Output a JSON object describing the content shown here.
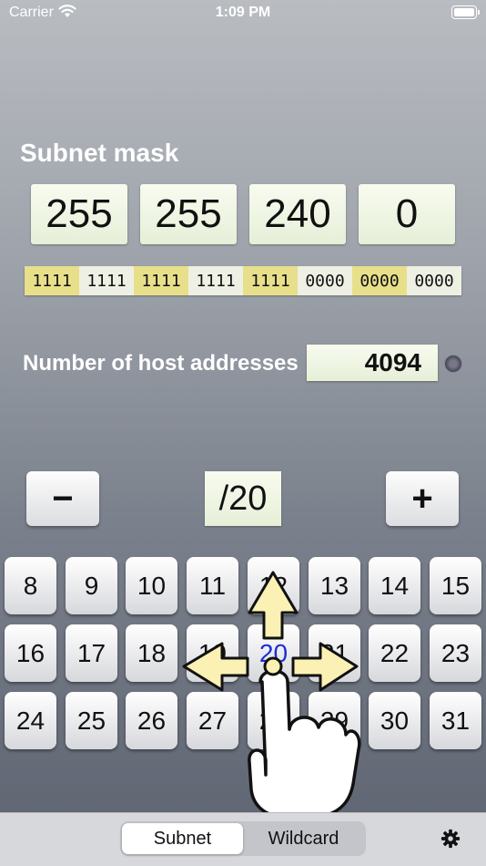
{
  "status": {
    "carrier": "Carrier",
    "time": "1:09 PM"
  },
  "title": "Subnet mask",
  "octets": [
    "255",
    "255",
    "240",
    "0"
  ],
  "bits": [
    "1111",
    "1111",
    "1111",
    "1111",
    "1111",
    "0000",
    "0000",
    "0000"
  ],
  "hosts": {
    "label": "Number of host addresses",
    "value": "4094"
  },
  "controls": {
    "minus": "−",
    "prefix": "/20",
    "plus": "+"
  },
  "keypad": [
    "8",
    "9",
    "10",
    "11",
    "12",
    "13",
    "14",
    "15",
    "16",
    "17",
    "18",
    "19",
    "20",
    "21",
    "22",
    "23",
    "24",
    "25",
    "26",
    "27",
    "28",
    "29",
    "30",
    "31"
  ],
  "active_key": "20",
  "tabs": [
    "Subnet",
    "Wildcard"
  ],
  "selected_tab": "Subnet",
  "icons": {
    "wifi": "wifi-icon",
    "battery": "battery-icon",
    "info": "info-dot-icon",
    "settings": "gear-icon",
    "gesture": "hand-swipe-hint-icon"
  },
  "colors": {
    "highlight": "#e8df8b",
    "field": "#eef3e2",
    "active_key_text": "#1d2fd6"
  }
}
